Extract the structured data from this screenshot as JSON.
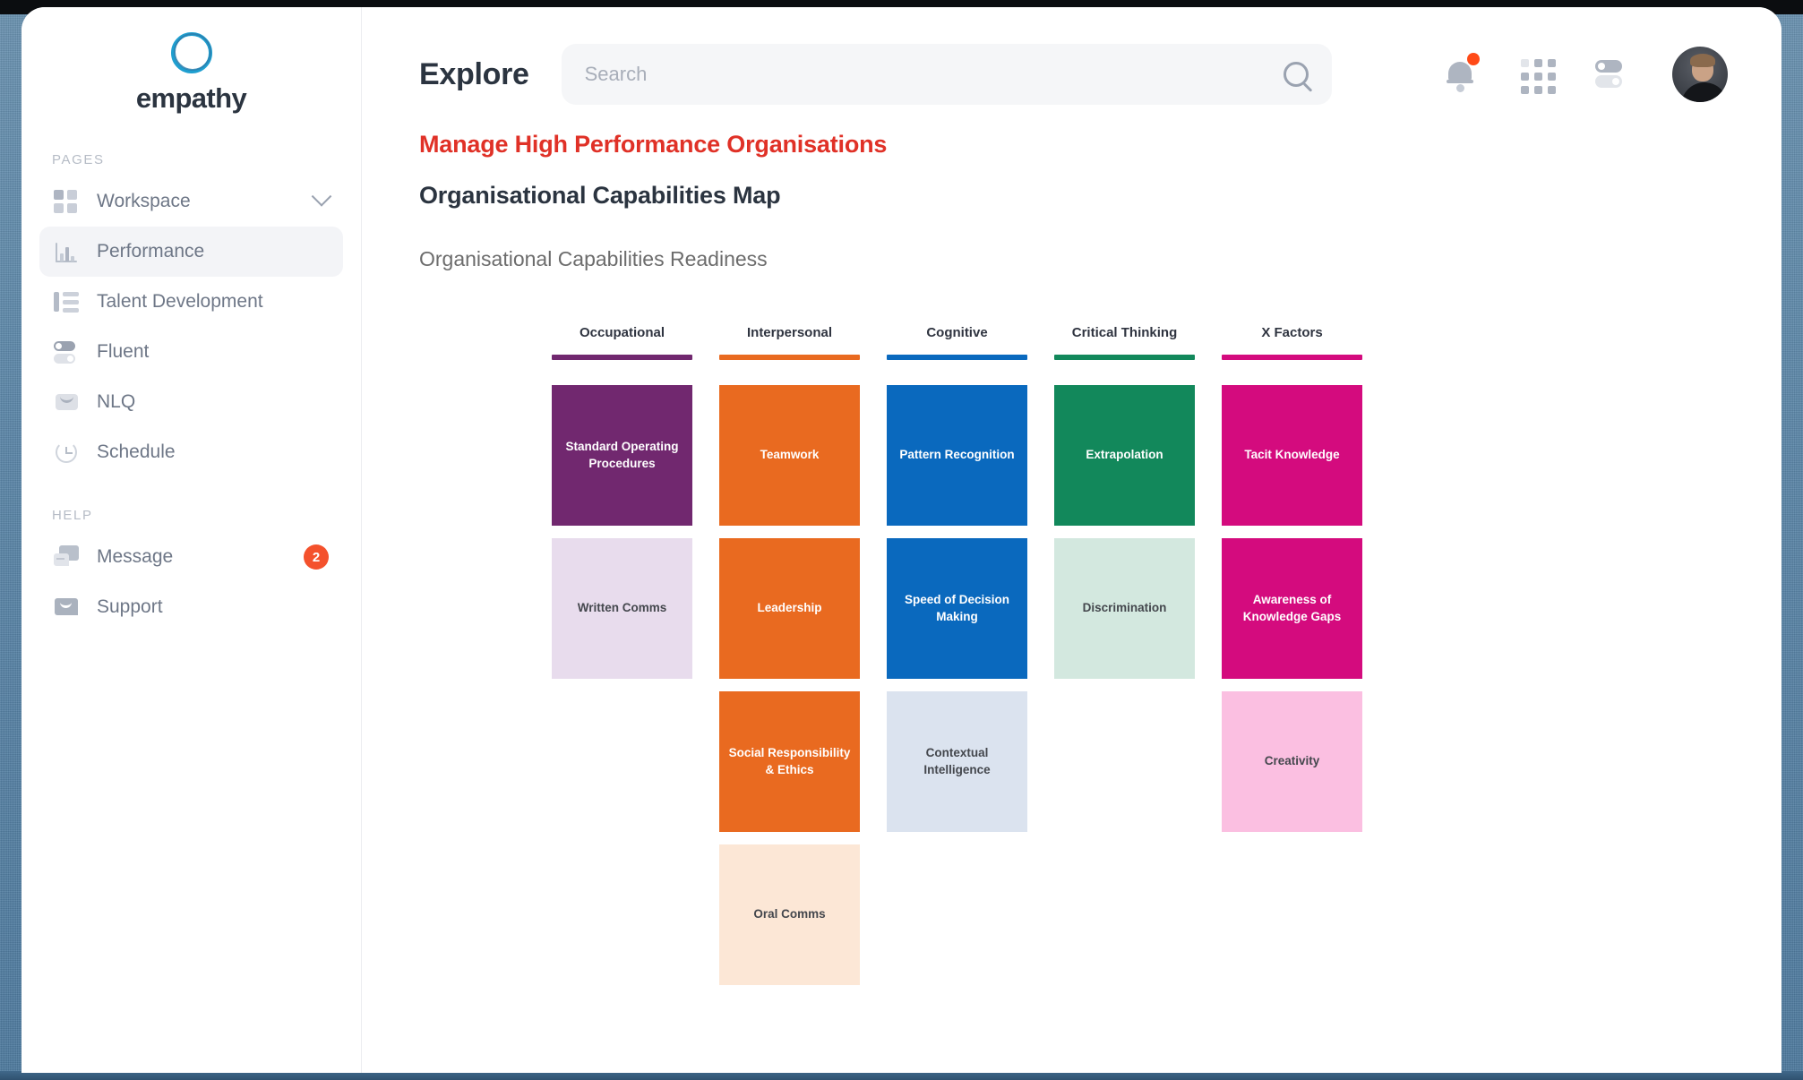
{
  "sidebar": {
    "brand": {
      "name": "empathy",
      "logo_icon": "circle-ring-logo",
      "accent": "#1f9fd0"
    },
    "sections": [
      {
        "label": "PAGES"
      },
      {
        "label": "HELP"
      }
    ],
    "pages": [
      {
        "label": "Workspace",
        "icon": "grid-squares-icon",
        "active": false,
        "chevron": true
      },
      {
        "label": "Performance",
        "icon": "bar-chart-icon",
        "active": true,
        "chevron": false
      },
      {
        "label": "Talent Development",
        "icon": "list-lines-icon",
        "active": false,
        "chevron": false
      },
      {
        "label": "Fluent",
        "icon": "toggle-switch-icon",
        "active": false,
        "chevron": false
      },
      {
        "label": "NLQ",
        "icon": "envelope-icon",
        "active": false,
        "chevron": false
      },
      {
        "label": "Schedule",
        "icon": "clock-history-icon",
        "active": false,
        "chevron": false
      }
    ],
    "help": [
      {
        "label": "Message",
        "icon": "chat-bubbles-icon",
        "badge": "2"
      },
      {
        "label": "Support",
        "icon": "speech-bubble-icon",
        "badge": ""
      }
    ],
    "badge_color": "#f4512c"
  },
  "header": {
    "title": "Explore",
    "search": {
      "placeholder": "Search",
      "value": "",
      "icon": "search-icon"
    },
    "actions": [
      {
        "name": "notifications",
        "icon": "bell-icon",
        "has_dot": true,
        "dot_color": "#ff4a17"
      },
      {
        "name": "apps",
        "icon": "apps-grid-icon"
      },
      {
        "name": "settings",
        "icon": "toggle-switch-icon"
      },
      {
        "name": "profile",
        "icon": "user-avatar"
      }
    ]
  },
  "content": {
    "eyebrow": "Manage High Performance Organisations",
    "eyebrow_color": "#e03127",
    "title": "Organisational Capabilities Map",
    "subtitle": "Organisational Capabilities Readiness"
  },
  "chart_data": {
    "type": "table",
    "title": "Organisational Capabilities Map",
    "subtitle": "Organisational Capabilities Readiness",
    "legend_position": "column-headers",
    "columns": [
      {
        "name": "Occupational",
        "color": "#71286f",
        "cells": [
          {
            "label": "Standard Operating Procedures",
            "bg": "#71286f",
            "fg": "#ffffff"
          },
          {
            "label": "Written Comms",
            "bg": "#e8dced",
            "fg": "#44474d"
          }
        ]
      },
      {
        "name": "Interpersonal",
        "color": "#e96a20",
        "cells": [
          {
            "label": "Teamwork",
            "bg": "#e96a20",
            "fg": "#ffffff"
          },
          {
            "label": "Leadership",
            "bg": "#e96a20",
            "fg": "#ffffff"
          },
          {
            "label": "Social Responsibility & Ethics",
            "bg": "#e96a20",
            "fg": "#ffffff"
          },
          {
            "label": "Oral Comms",
            "bg": "#fce7d6",
            "fg": "#44474d"
          }
        ]
      },
      {
        "name": "Cognitive",
        "color": "#0a69be",
        "cells": [
          {
            "label": "Pattern Recognition",
            "bg": "#0a69be",
            "fg": "#ffffff"
          },
          {
            "label": "Speed of Decision Making",
            "bg": "#0a69be",
            "fg": "#ffffff"
          },
          {
            "label": "Contextual Intelligence",
            "bg": "#dbe3ef",
            "fg": "#44474d"
          }
        ]
      },
      {
        "name": "Critical Thinking",
        "color": "#12885b",
        "cells": [
          {
            "label": "Extrapolation",
            "bg": "#12885b",
            "fg": "#ffffff"
          },
          {
            "label": "Discrimination",
            "bg": "#d3e8df",
            "fg": "#44474d"
          }
        ]
      },
      {
        "name": "X Factors",
        "color": "#d40b7e",
        "cells": [
          {
            "label": "Tacit Knowledge",
            "bg": "#d40b7e",
            "fg": "#ffffff"
          },
          {
            "label": "Awareness of Knowledge Gaps",
            "bg": "#d40b7e",
            "fg": "#ffffff"
          },
          {
            "label": "Creativity",
            "bg": "#fbbfe1",
            "fg": "#44474d"
          }
        ]
      }
    ]
  }
}
